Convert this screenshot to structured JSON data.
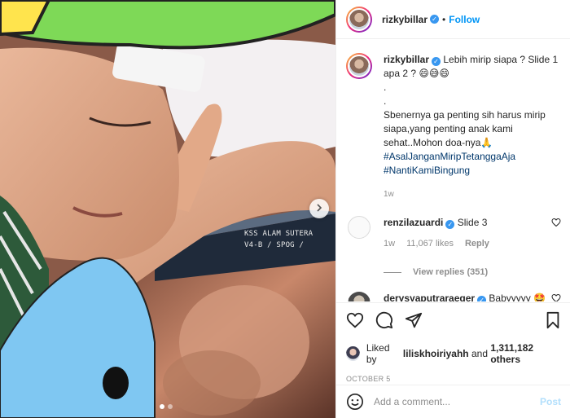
{
  "post": {
    "username": "rizkybillar",
    "follow_label": "Follow",
    "separator": "•"
  },
  "caption": {
    "username": "rizkybillar",
    "line1": "Lebih mirip siapa ? Slide 1 apa 2 ? 😄😅😄",
    "dot1": ".",
    "dot2": ".",
    "line2": "Sbenernya ga penting sih harus mirip siapa,yang penting anak kami sehat..Mohon doa-nya🙏",
    "hashtags": [
      "#AsalJanganMiripTetanggaAja",
      "#NantiKamiBingung"
    ],
    "age": "1w"
  },
  "comments": [
    {
      "username": "renzilazuardi",
      "text": "Slide 3",
      "age": "1w",
      "likes": "11,067 likes",
      "reply_label": "Reply",
      "view_replies": "View replies (351)"
    },
    {
      "username": "derysyaputraraeger",
      "text": "Babyyyyy 🤩"
    }
  ],
  "likes": {
    "liked_by_prefix": "Liked by",
    "liked_by_user": "liliskhoiriyahh",
    "and": "and",
    "others": "1,311,182 others"
  },
  "date": "OCTOBER 5",
  "add_comment": {
    "placeholder": "Add a comment...",
    "post_label": "Post"
  },
  "media": {
    "monitor_text_1": "KSS ALAM SUTERA",
    "monitor_text_2": "V4-B / SPOG /",
    "slide_count": 2,
    "active_slide": 1
  },
  "icons": {
    "like": "heart-icon",
    "comment": "comment-icon",
    "share": "paper-plane-icon",
    "save": "bookmark-icon",
    "emoji": "smiley-icon",
    "next": "chevron-right-icon"
  },
  "colors": {
    "link": "#0095f6",
    "verified": "#3897f0",
    "hashtag": "#00376b",
    "muted": "#8e8e8e"
  }
}
